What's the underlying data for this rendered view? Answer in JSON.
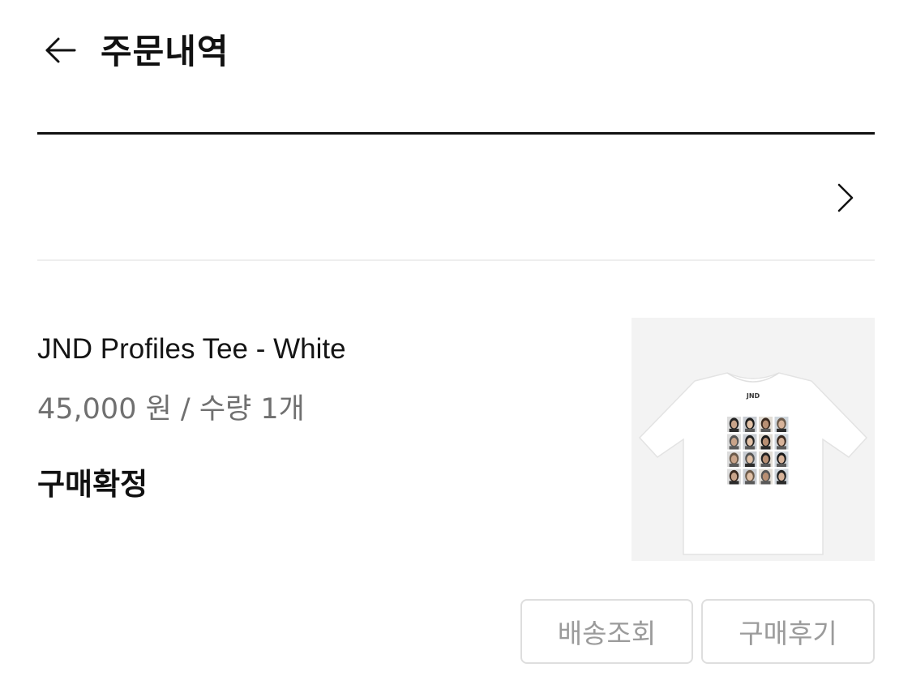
{
  "header": {
    "back_icon": "arrow-left-icon",
    "title": "주문내역"
  },
  "order": {
    "chevron_icon": "chevron-right-icon"
  },
  "product": {
    "name": "JND Profiles Tee - White",
    "price_quantity": "45,000 원 / 수량 1개",
    "status": "구매확정",
    "image_icon": "white-tshirt-with-portrait-grid",
    "image_print_text": "JND"
  },
  "actions": {
    "track_label": "배송조회",
    "review_label": "구매후기"
  },
  "colors": {
    "text": "#111111",
    "muted": "#707070",
    "button_text": "#9b9b9b",
    "button_border": "#dedede",
    "divider_light": "#eeeeee",
    "image_bg": "#f3f3f3"
  }
}
